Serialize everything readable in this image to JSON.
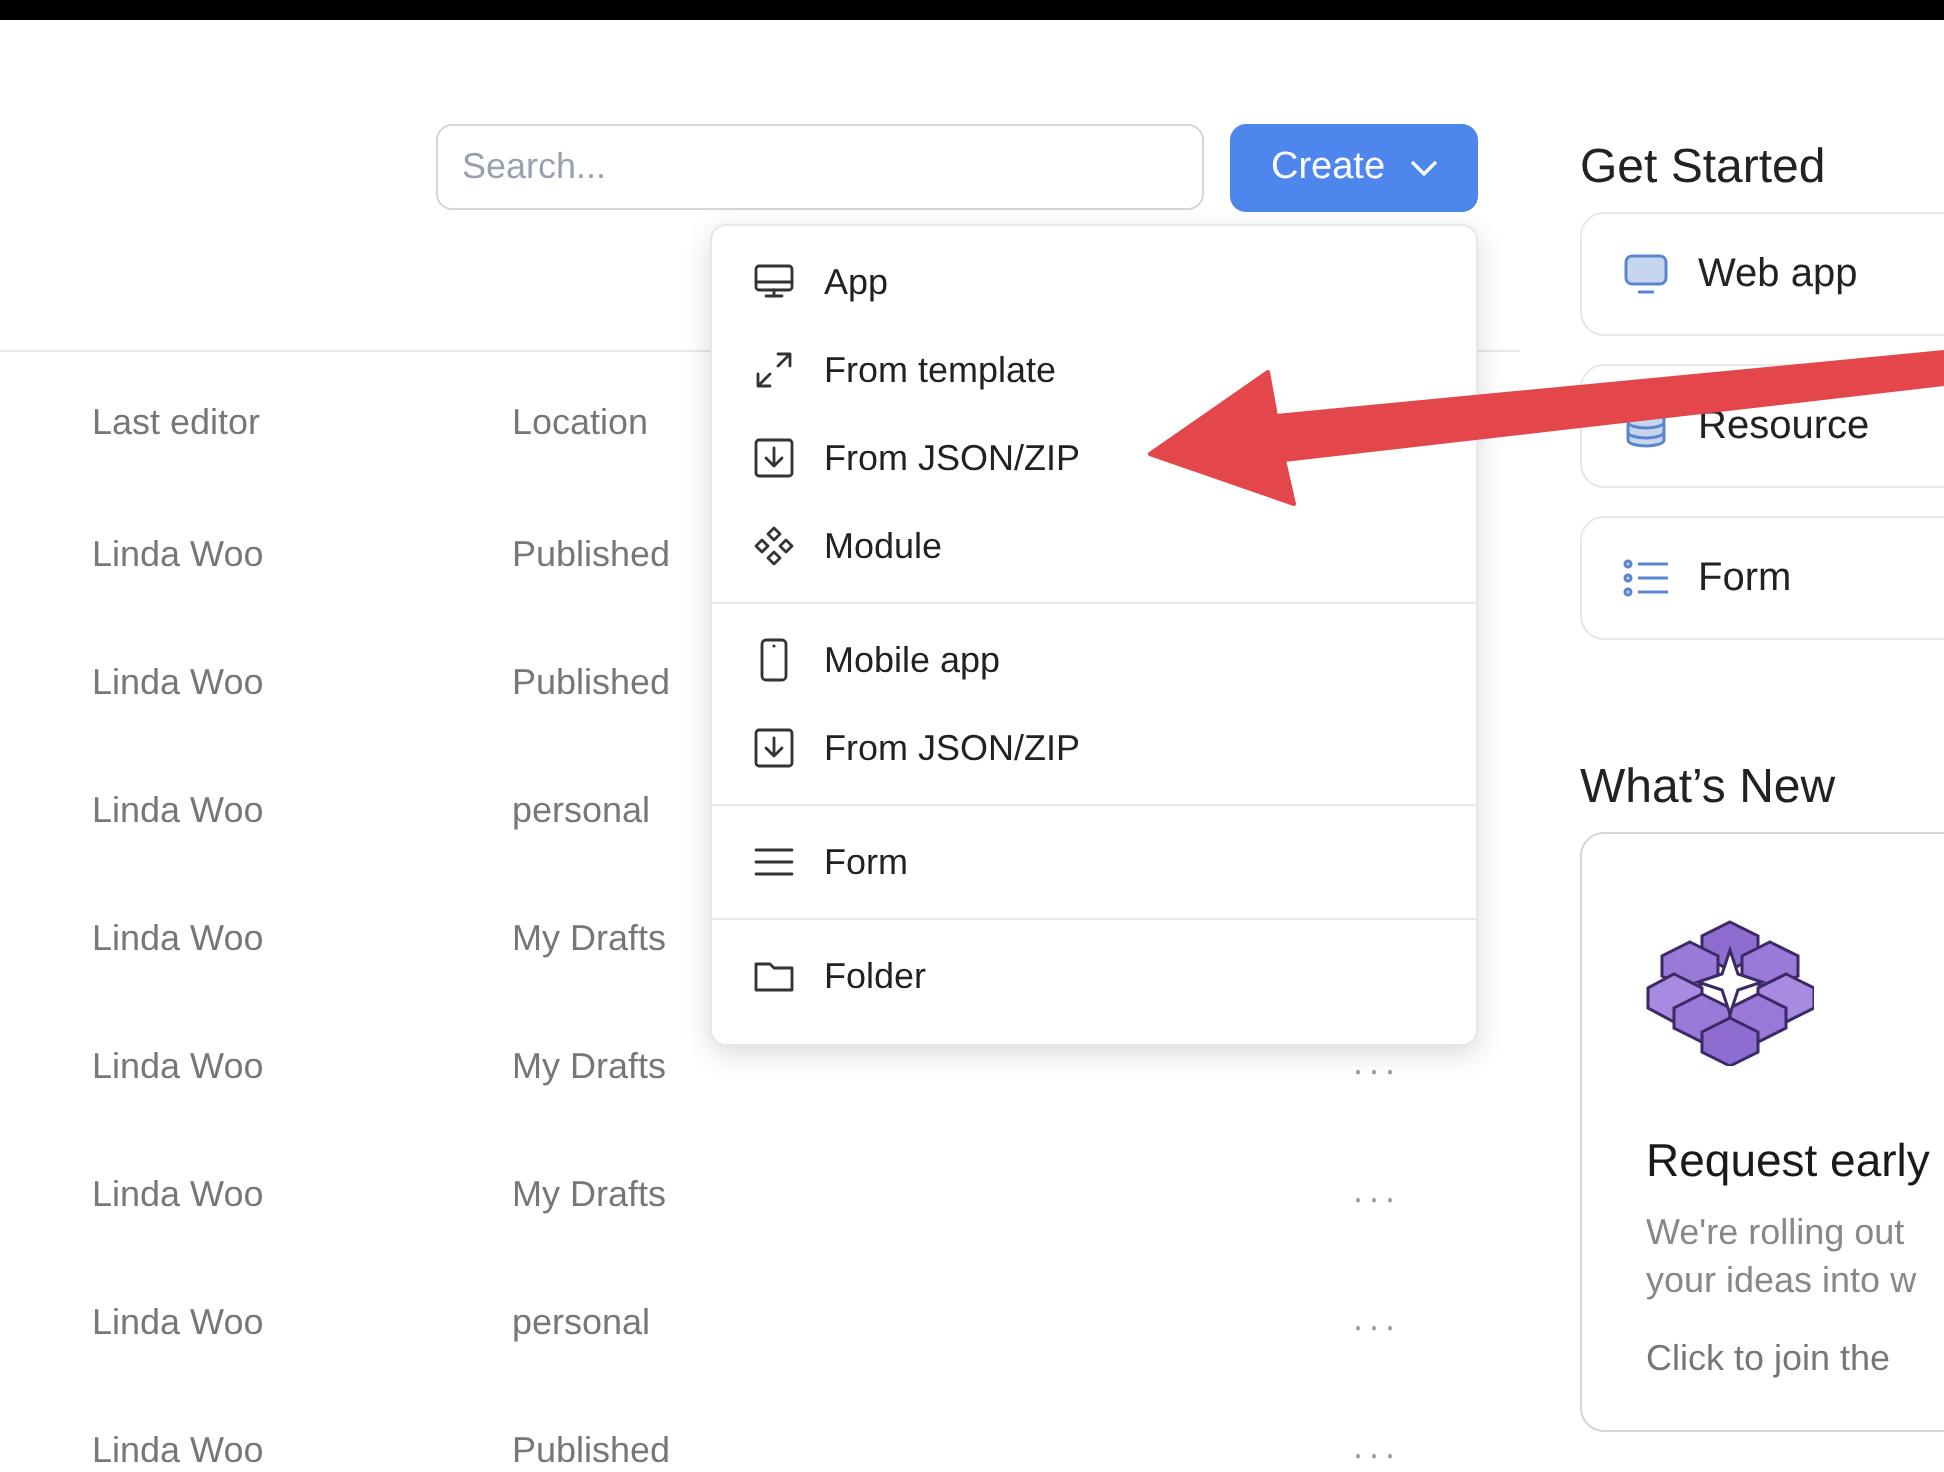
{
  "search": {
    "placeholder": "Search..."
  },
  "create_button": {
    "label": "Create",
    "expanded": true
  },
  "table": {
    "columns": [
      "Last editor",
      "Location"
    ],
    "rows": [
      {
        "last_editor": "Linda Woo",
        "location": "Published"
      },
      {
        "last_editor": "Linda Woo",
        "location": "Published"
      },
      {
        "last_editor": "Linda Woo",
        "location": "personal"
      },
      {
        "last_editor": "Linda Woo",
        "location": "My Drafts"
      },
      {
        "last_editor": "Linda Woo",
        "location": "My Drafts",
        "actions": "···"
      },
      {
        "last_editor": "Linda Woo",
        "location": "My Drafts",
        "actions": "···"
      },
      {
        "last_editor": "Linda Woo",
        "location": "personal",
        "actions": "···"
      },
      {
        "last_editor": "Linda Woo",
        "location": "Published",
        "actions": "···"
      }
    ]
  },
  "create_menu": {
    "sections": [
      [
        {
          "kind": "desktop",
          "label": "App"
        },
        {
          "kind": "expand",
          "label": "From template"
        },
        {
          "kind": "import",
          "label": "From JSON/ZIP"
        },
        {
          "kind": "module",
          "label": "Module"
        }
      ],
      [
        {
          "kind": "mobile",
          "label": "Mobile app"
        },
        {
          "kind": "import",
          "label": "From JSON/ZIP"
        }
      ],
      [
        {
          "kind": "lines",
          "label": "Form"
        }
      ],
      [
        {
          "kind": "folder",
          "label": "Folder"
        }
      ]
    ]
  },
  "get_started": {
    "title": "Get Started",
    "items": [
      {
        "kind": "monitor",
        "label": "Web app"
      },
      {
        "kind": "database",
        "label": "Resource"
      },
      {
        "kind": "list",
        "label": "Form"
      }
    ]
  },
  "whats_new": {
    "title": "What’s New",
    "card": {
      "heading": "Request early",
      "lines": [
        "We're rolling out",
        "your ideas into w"
      ],
      "link": "Click to join the"
    }
  }
}
